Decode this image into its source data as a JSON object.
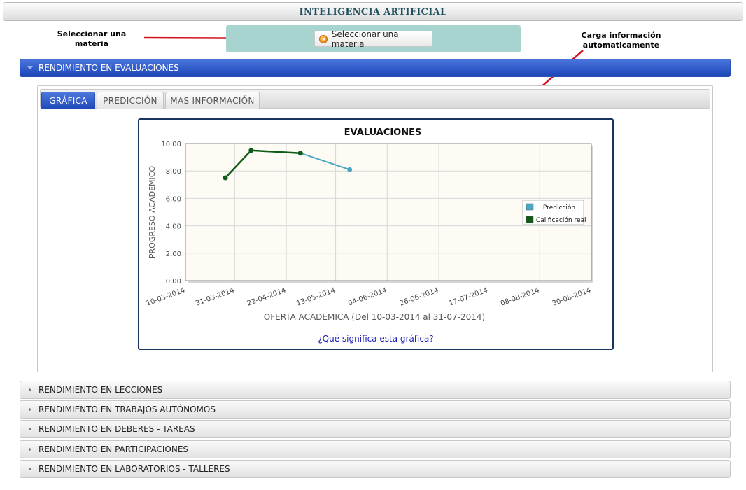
{
  "app": {
    "title": "INTELIGENCIA ARTIFICIAL"
  },
  "annotations": {
    "select": [
      "Seleccionar una",
      "materia"
    ],
    "load": [
      "Carga información",
      "automaticamente"
    ]
  },
  "select_button": {
    "label": "Seleccionar una materia"
  },
  "accordion": {
    "active": {
      "label": "RENDIMIENTO EN EVALUACIONES"
    },
    "items": [
      {
        "label": "RENDIMIENTO EN LECCIONES"
      },
      {
        "label": "RENDIMIENTO EN TRABAJOS AUTÓNOMOS"
      },
      {
        "label": "RENDIMIENTO EN DEBERES - TAREAS"
      },
      {
        "label": "RENDIMIENTO EN PARTICIPACIONES"
      },
      {
        "label": "RENDIMIENTO EN LABORATORIOS - TALLERES"
      }
    ]
  },
  "tabs": [
    {
      "label": "GRÁFICA",
      "active": true
    },
    {
      "label": "PREDICCIÓN",
      "active": false
    },
    {
      "label": "MAS INFORMACIÓN",
      "active": false
    }
  ],
  "chart_link": "¿Qué significa esta gráfica?",
  "colors": {
    "header_blue": "#2a4fb3",
    "prediction": "#4aa8c4",
    "actual": "#0e5a16",
    "plot_bg": "#fdfbf4",
    "arrow": "#d4121e"
  },
  "chart_data": {
    "type": "line",
    "title": "EVALUACIONES",
    "xlabel": "OFERTA ACADEMICA (Del 10-03-2014 al 31-07-2014)",
    "ylabel": "PROGRESO ACADEMICO",
    "x_ticks": [
      "10-03-2014",
      "31-03-2014",
      "22-04-2014",
      "13-05-2014",
      "04-06-2014",
      "26-06-2014",
      "17-07-2014",
      "08-08-2014",
      "30-08-2014"
    ],
    "y_ticks": [
      "0.00",
      "2.00",
      "4.00",
      "6.00",
      "8.00",
      "10.00"
    ],
    "ylim": [
      0,
      10
    ],
    "grid": true,
    "legend": "right",
    "series": [
      {
        "name": "Predicción",
        "color": "#4aa8c4",
        "points": [
          [
            "2014-04-07",
            9.5
          ],
          [
            "2014-04-28",
            9.3
          ],
          [
            "2014-05-19",
            8.1
          ]
        ]
      },
      {
        "name": "Calificación real",
        "color": "#0e5a16",
        "points": [
          [
            "2014-03-27",
            7.5
          ],
          [
            "2014-04-07",
            9.5
          ],
          [
            "2014-04-28",
            9.3
          ]
        ]
      }
    ]
  }
}
